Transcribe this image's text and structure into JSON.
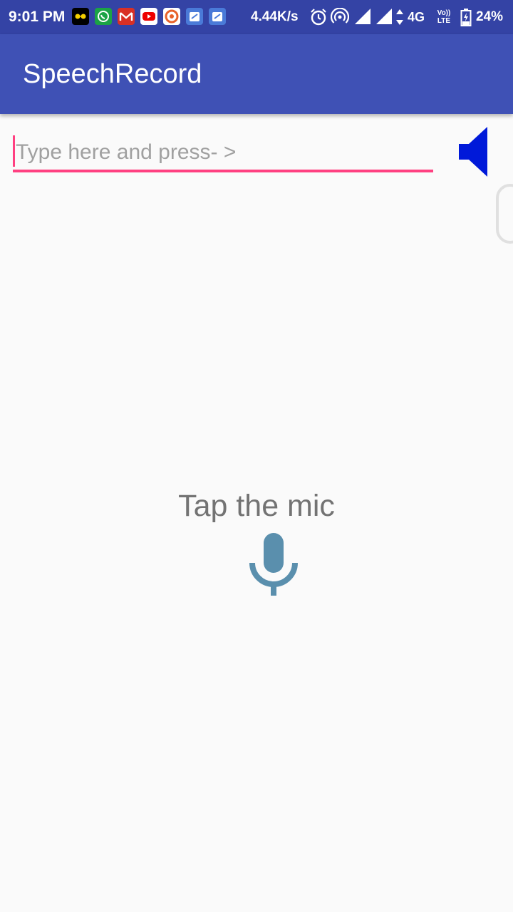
{
  "status_bar": {
    "time": "9:01 PM",
    "net_speed": "4.44K/s",
    "network_type": "4G",
    "volte_top": "Vo))",
    "volte_bottom": "LTE",
    "battery": "24%",
    "notification_icons": [
      "glasses-app-icon",
      "whatsapp-icon",
      "gmail-icon",
      "youtube-icon",
      "app-notification-icon",
      "calendar-notification-icon",
      "calendar-notification-icon"
    ],
    "colors": {
      "background": "#3443a5"
    }
  },
  "app_bar": {
    "title": "SpeechRecord",
    "color": "#3f51b5"
  },
  "input": {
    "placeholder": "Type here and press- >",
    "value": "",
    "accent_color": "#ff4081"
  },
  "speaker": {
    "icon": "speaker-icon",
    "color": "#0019d9"
  },
  "main": {
    "prompt": "Tap the mic",
    "mic_icon": "microphone-icon",
    "mic_color": "#5a8fad"
  }
}
